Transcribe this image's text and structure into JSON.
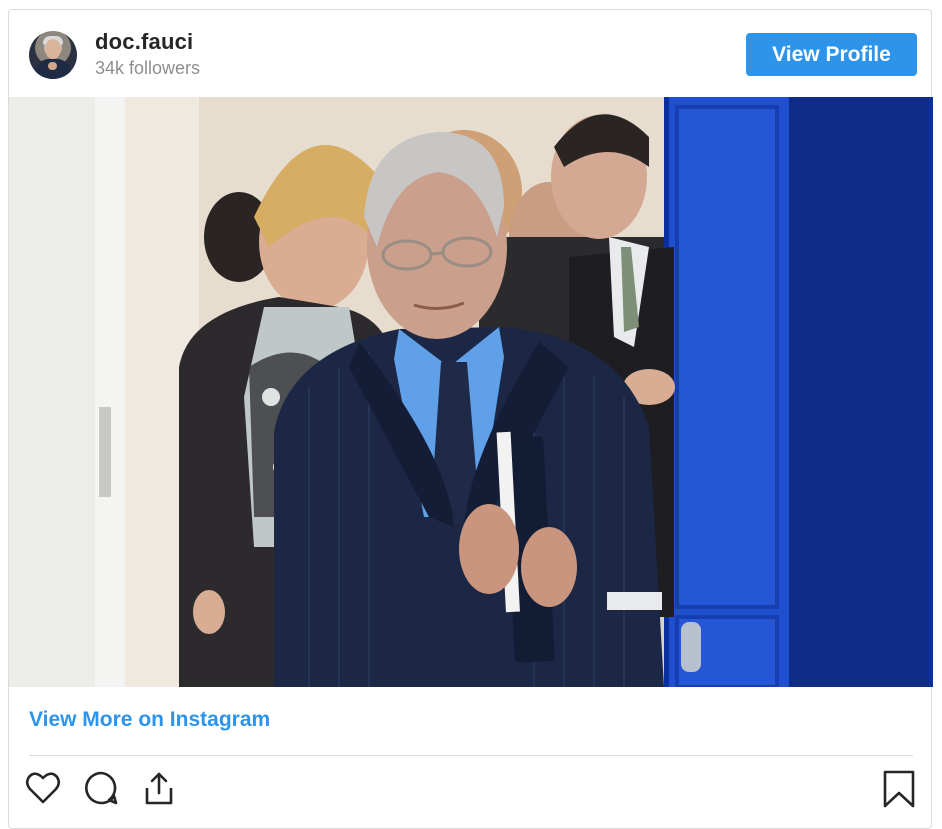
{
  "profile": {
    "username": "doc.fauci",
    "followers": "34k followers",
    "view_profile_label": "View Profile",
    "avatar_icon": "profile-avatar"
  },
  "post": {
    "image_description_icon": "post-photo",
    "view_more_label": "View More on Instagram"
  },
  "actions": {
    "like_icon": "heart-icon",
    "comment_icon": "comment-icon",
    "share_icon": "share-icon",
    "save_icon": "bookmark-icon"
  },
  "colors": {
    "accent": "#2e94e9",
    "text_primary": "#262626",
    "text_secondary": "#8e8e8e",
    "border": "#dbdbdb"
  }
}
